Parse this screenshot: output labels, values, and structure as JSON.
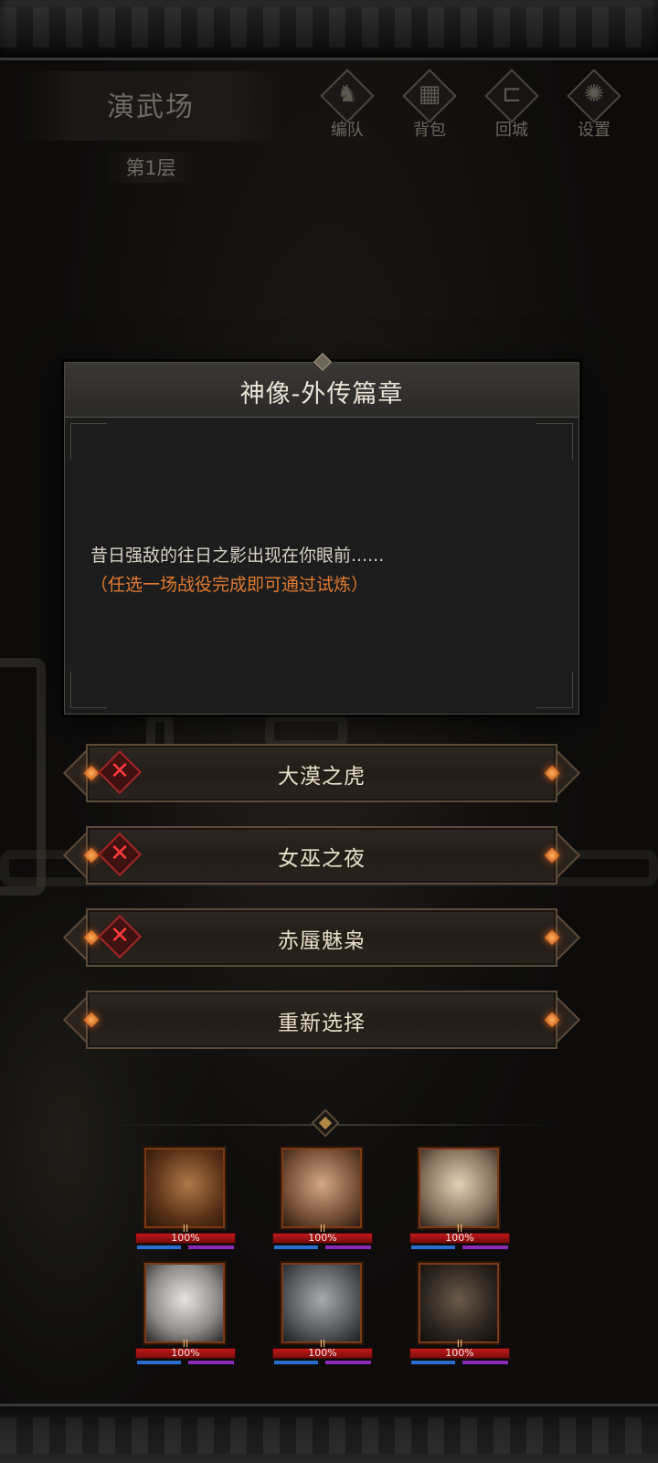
{
  "header": {
    "location": "演武场",
    "floor": "第1层"
  },
  "menu": [
    {
      "label": "编队",
      "icon": "helmet-icon",
      "glyph": "♞"
    },
    {
      "label": "背包",
      "icon": "backpack-icon",
      "glyph": "▦"
    },
    {
      "label": "回城",
      "icon": "door-icon",
      "glyph": "⊏"
    },
    {
      "label": "设置",
      "icon": "gear-icon",
      "glyph": "✺"
    }
  ],
  "dialog": {
    "title": "神像-外传篇章",
    "text": "昔日强敌的往日之影出现在你眼前......",
    "hint": "（任选一场战役完成即可通过试炼）"
  },
  "choices": [
    {
      "label": "大漠之虎",
      "failed": true
    },
    {
      "label": "女巫之夜",
      "failed": true
    },
    {
      "label": "赤蜃魅枭",
      "failed": true
    },
    {
      "label": "重新选择",
      "failed": false
    }
  ],
  "colors": {
    "accent_orange": "#e07a30",
    "fail_red": "#ff3a3a",
    "hp_red": "#c01818",
    "mp_blue": "#2a6fd0",
    "sp_purple": "#8b2ab8"
  },
  "team": [
    {
      "name": "hero-1",
      "level": "II",
      "hp": "100%",
      "tone": "#7a4a2a"
    },
    {
      "name": "hero-2",
      "level": "II",
      "hp": "100%",
      "tone": "#8a6a52"
    },
    {
      "name": "hero-3",
      "level": "II",
      "hp": "100%",
      "tone": "#9a8a78"
    },
    {
      "name": "hero-4",
      "level": "II",
      "hp": "100%",
      "tone": "#9aa0a2"
    },
    {
      "name": "hero-5",
      "level": "II",
      "hp": "100%",
      "tone": "#5a5e62"
    },
    {
      "name": "hero-6",
      "level": "II",
      "hp": "100%",
      "tone": "#3a2a20"
    }
  ]
}
